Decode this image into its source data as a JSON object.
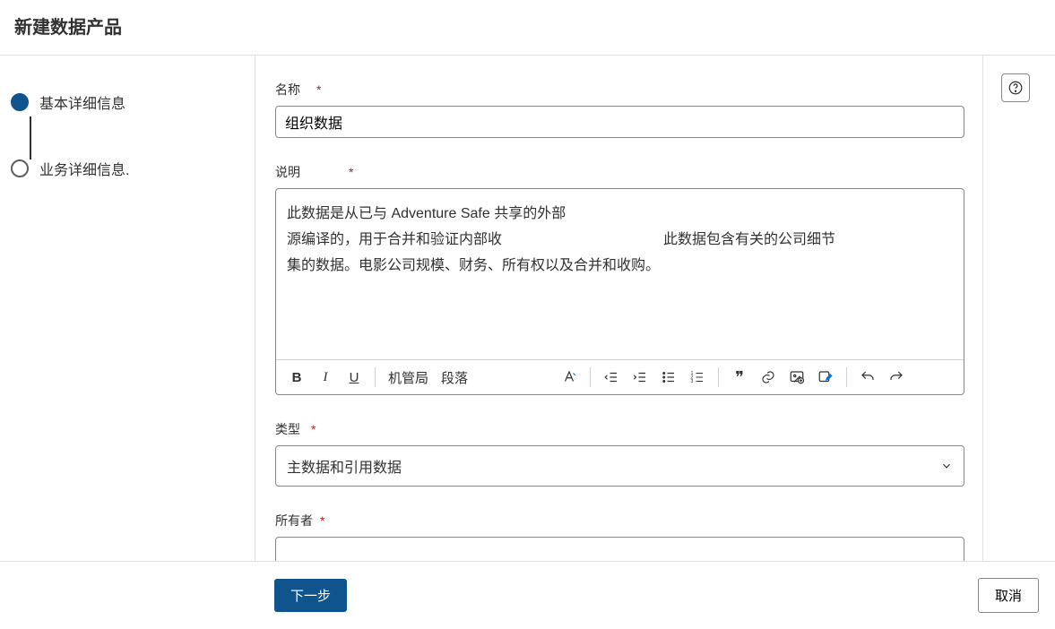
{
  "header": {
    "title": "新建数据产品"
  },
  "steps": [
    {
      "label": "基本详细信息",
      "active": true
    },
    {
      "label": "业务详细信息.",
      "active": false
    }
  ],
  "form": {
    "name": {
      "label": "名称",
      "required": "*",
      "value": "组织数据"
    },
    "description": {
      "label": "说明",
      "required": "*",
      "lines": {
        "l1": "此数据是从已与 Adventure Safe 共享的外部",
        "l2a": "源编译的，用于合并和验证内部收",
        "l2b": "此数据包含有关的公司细节",
        "l3": "集的数据。电影公司规模、财务、所有权以及合并和收购。"
      }
    },
    "type": {
      "label": "类型",
      "required": "*",
      "value": "主数据和引用数据"
    },
    "owner": {
      "label": "所有者",
      "required": "*",
      "value": ""
    }
  },
  "toolbar": {
    "heading_short": "机管局",
    "paragraph": "段落"
  },
  "footer": {
    "next": "下一步",
    "cancel": "取消"
  }
}
